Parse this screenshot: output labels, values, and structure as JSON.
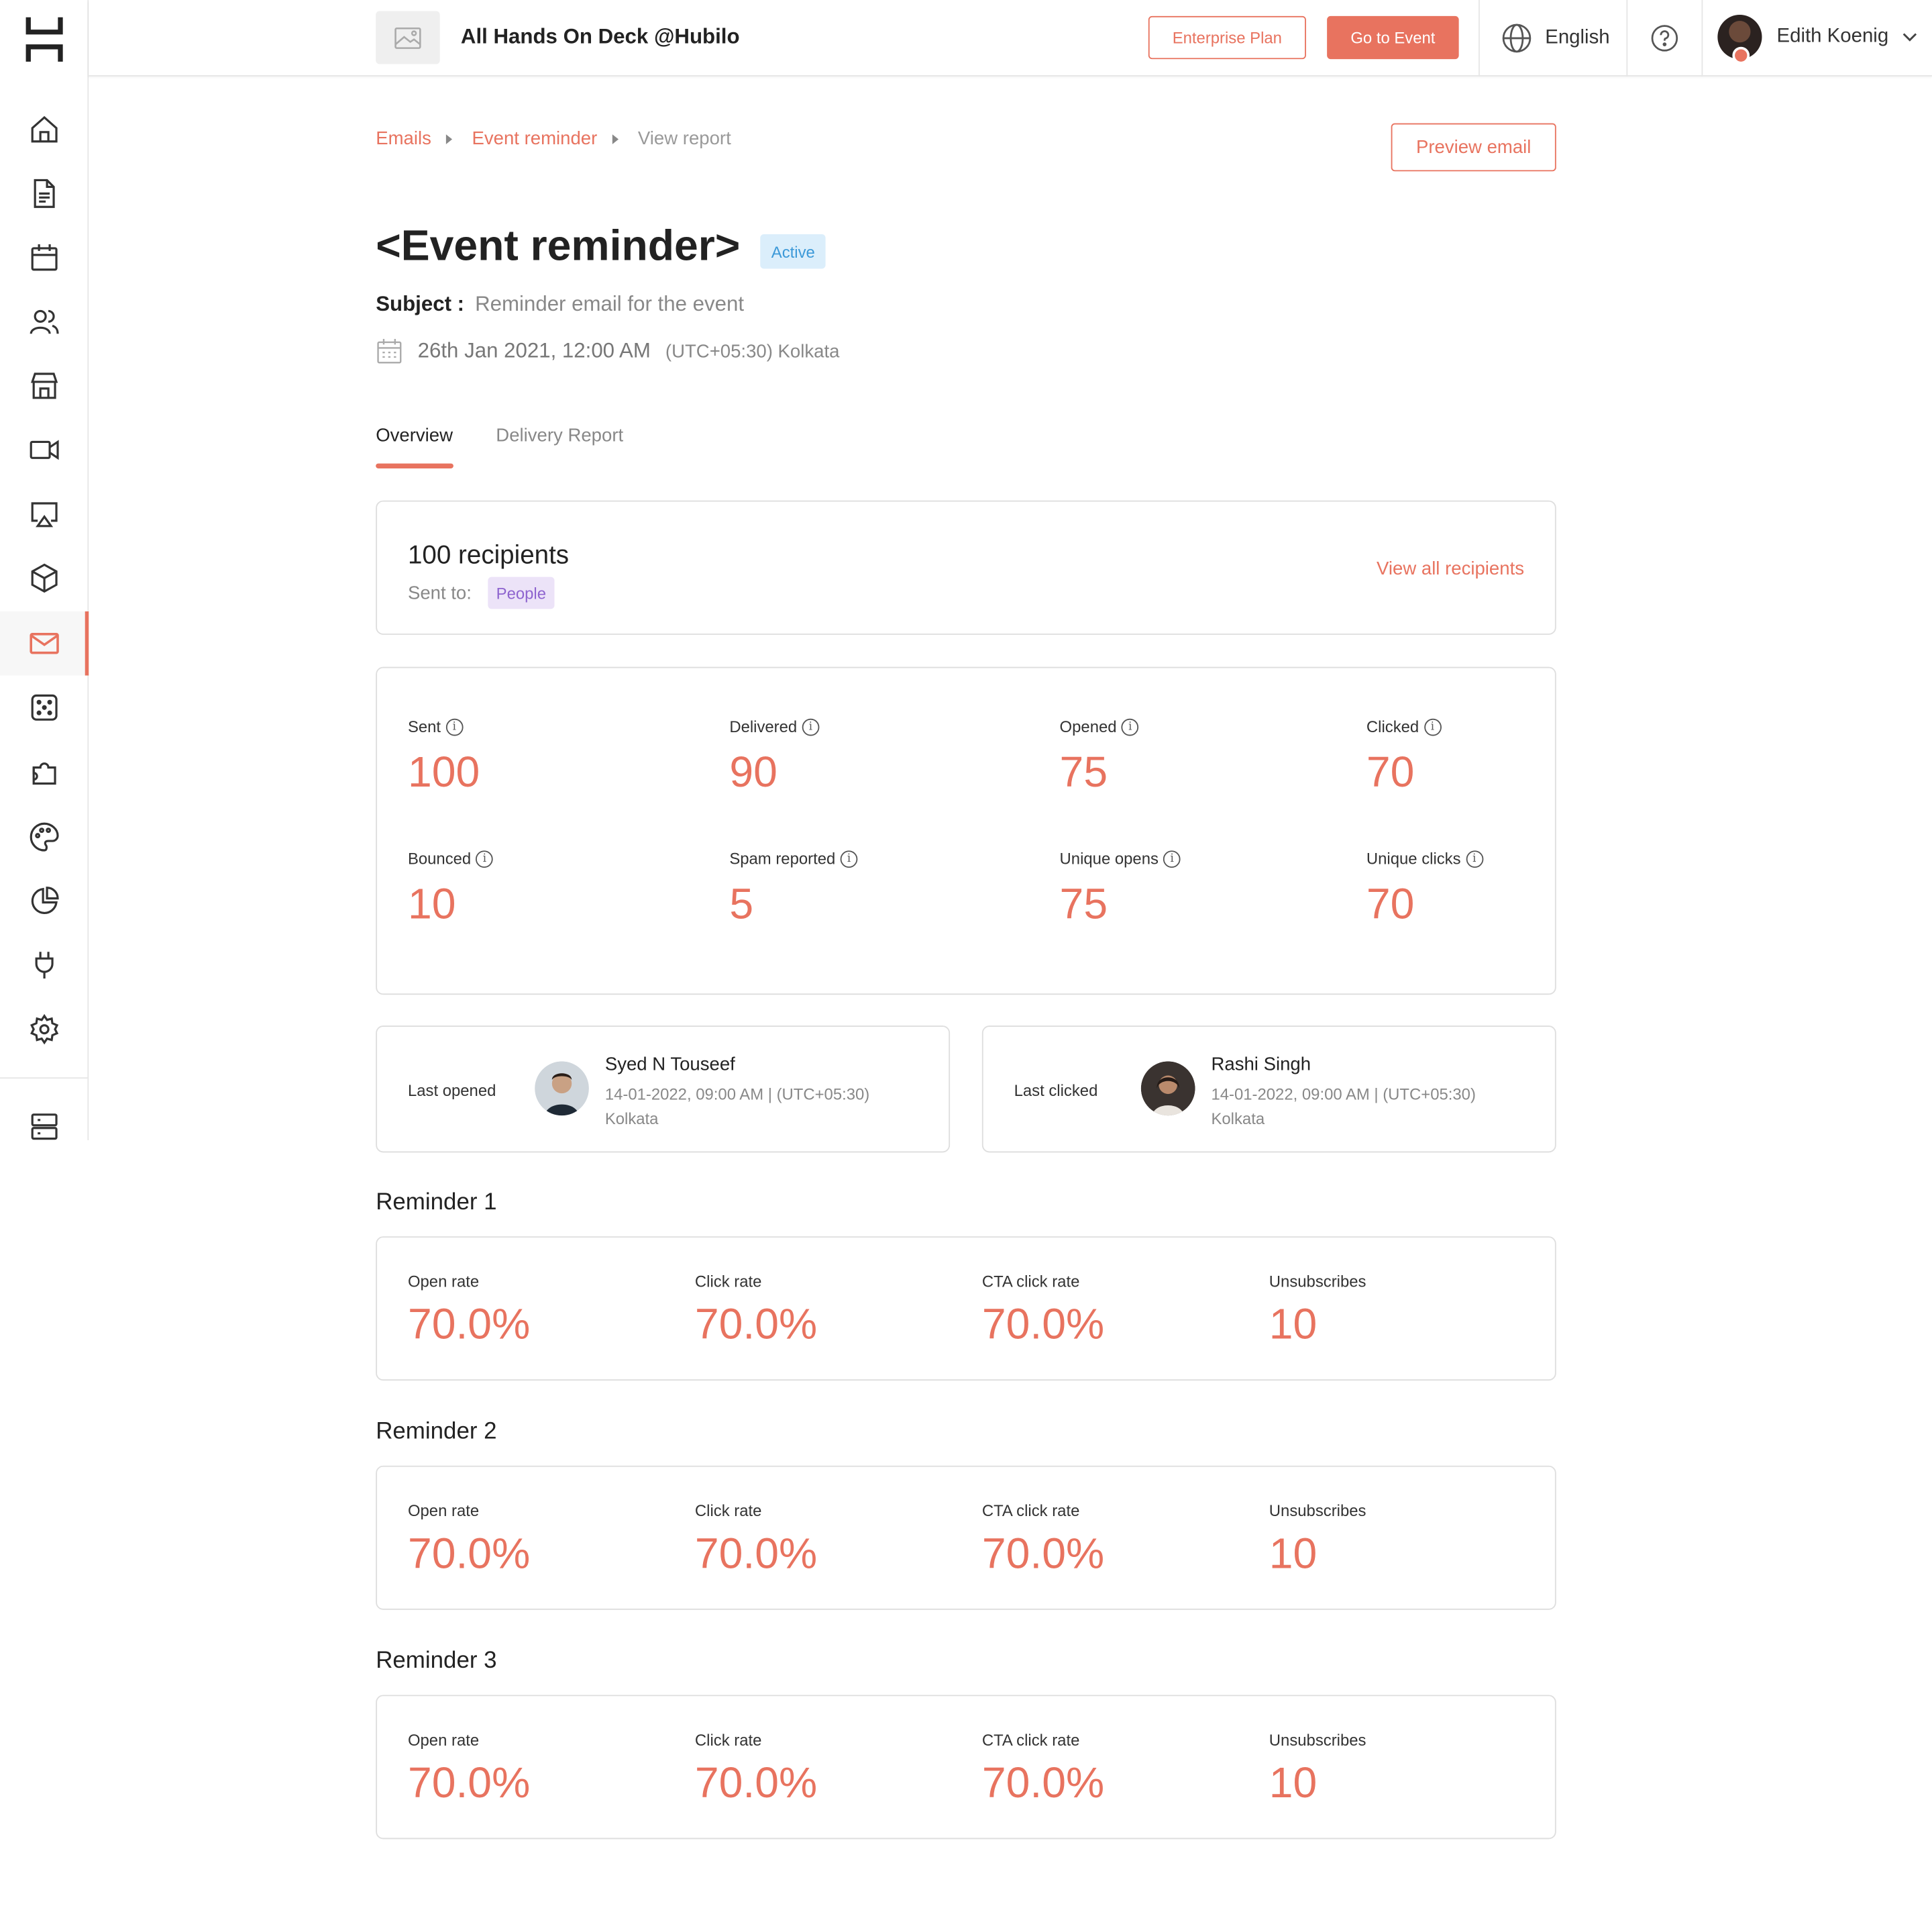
{
  "app": {
    "event_title": "All Hands On Deck @Hubilo",
    "accent_color": "#e8735f"
  },
  "header": {
    "enterprise_plan": "Enterprise Plan",
    "go_to_event": "Go to Event",
    "language": "English",
    "user_name": "Edith Koenig"
  },
  "sidebar": {
    "items": [
      {
        "icon": "home-icon"
      },
      {
        "icon": "document-icon"
      },
      {
        "icon": "calendar-icon"
      },
      {
        "icon": "people-icon"
      },
      {
        "icon": "store-icon"
      },
      {
        "icon": "video-icon"
      },
      {
        "icon": "screen-cast-icon"
      },
      {
        "icon": "box-icon"
      },
      {
        "icon": "mail-icon",
        "active": true
      },
      {
        "icon": "dice-icon"
      },
      {
        "icon": "puzzle-icon"
      },
      {
        "icon": "palette-icon"
      },
      {
        "icon": "pie-chart-icon"
      },
      {
        "icon": "plug-icon"
      },
      {
        "icon": "gear-icon"
      },
      {
        "icon": "server-icon"
      }
    ]
  },
  "breadcrumb": {
    "emails": "Emails",
    "event_reminder": "Event reminder",
    "view_report": "View report"
  },
  "preview_email": "Preview email",
  "page": {
    "title": "<Event reminder>",
    "status": "Active",
    "subject_label": "Subject :",
    "subject_value": "Reminder email for the event",
    "date": "26th Jan 2021, 12:00 AM",
    "timezone": "(UTC+05:30) Kolkata"
  },
  "tabs": {
    "overview": "Overview",
    "delivery_report": "Delivery Report"
  },
  "recipients": {
    "count": "100 recipients",
    "sent_to_label": "Sent to:",
    "sent_to_value": "People",
    "view_all": "View all recipients"
  },
  "stats": {
    "sent": {
      "label": "Sent",
      "value": "100"
    },
    "delivered": {
      "label": "Delivered",
      "value": "90"
    },
    "opened": {
      "label": "Opened",
      "value": "75"
    },
    "clicked": {
      "label": "Clicked",
      "value": "70"
    },
    "bounced": {
      "label": "Bounced",
      "value": "10"
    },
    "spam": {
      "label": "Spam reported",
      "value": "5"
    },
    "unique_opens": {
      "label": "Unique opens",
      "value": "75"
    },
    "unique_clicks": {
      "label": "Unique clicks",
      "value": "70"
    }
  },
  "last_opened": {
    "label": "Last opened",
    "name": "Syed N Touseef",
    "time": "14-01-2022, 09:00 AM | (UTC+05:30) Kolkata"
  },
  "last_clicked": {
    "label": "Last clicked",
    "name": "Rashi Singh",
    "time": "14-01-2022, 09:00 AM | (UTC+05:30) Kolkata"
  },
  "reminders": [
    {
      "title": "Reminder 1",
      "open_rate_label": "Open rate",
      "open_rate": "70.0%",
      "click_rate_label": "Click rate",
      "click_rate": "70.0%",
      "cta_label": "CTA click rate",
      "cta": "70.0%",
      "unsub_label": "Unsubscribes",
      "unsub": "10"
    },
    {
      "title": "Reminder 2",
      "open_rate_label": "Open rate",
      "open_rate": "70.0%",
      "click_rate_label": "Click rate",
      "click_rate": "70.0%",
      "cta_label": "CTA click rate",
      "cta": "70.0%",
      "unsub_label": "Unsubscribes",
      "unsub": "10"
    },
    {
      "title": "Reminder 3",
      "open_rate_label": "Open rate",
      "open_rate": "70.0%",
      "click_rate_label": "Click rate",
      "click_rate": "70.0%",
      "cta_label": "CTA click rate",
      "cta": "70.0%",
      "unsub_label": "Unsubscribes",
      "unsub": "10"
    }
  ]
}
